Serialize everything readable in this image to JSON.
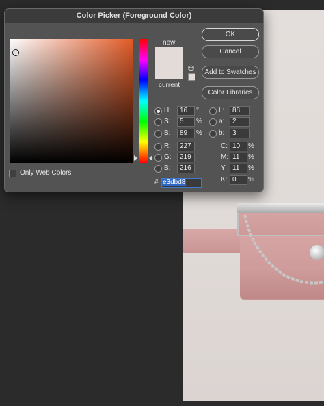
{
  "dialog": {
    "title": "Color Picker (Foreground Color)",
    "new_label": "new",
    "current_label": "current",
    "new_color": "#e3dbd8",
    "current_color": "#e3dbd8",
    "buttons": {
      "ok": "OK",
      "cancel": "Cancel",
      "add_to_swatches": "Add to Swatches",
      "color_libraries": "Color Libraries"
    },
    "only_web_colors": "Only Web Colors",
    "hsb": [
      {
        "label": "H:",
        "value": "16",
        "unit": "°",
        "selected": true
      },
      {
        "label": "S:",
        "value": "5",
        "unit": "%",
        "selected": false
      },
      {
        "label": "B:",
        "value": "89",
        "unit": "%",
        "selected": false
      }
    ],
    "rgb": [
      {
        "label": "R:",
        "value": "227"
      },
      {
        "label": "G:",
        "value": "219"
      },
      {
        "label": "B:",
        "value": "216"
      }
    ],
    "lab": [
      {
        "label": "L:",
        "value": "88"
      },
      {
        "label": "a:",
        "value": "2"
      },
      {
        "label": "b:",
        "value": "3"
      }
    ],
    "cmyk": [
      {
        "label": "C:",
        "value": "10",
        "unit": "%"
      },
      {
        "label": "M:",
        "value": "11",
        "unit": "%"
      },
      {
        "label": "Y:",
        "value": "11",
        "unit": "%"
      },
      {
        "label": "K:",
        "value": "0",
        "unit": "%"
      }
    ],
    "hex_prefix": "#",
    "hex_value": "e3dbd8",
    "field_hue_color": "#e25a26"
  }
}
